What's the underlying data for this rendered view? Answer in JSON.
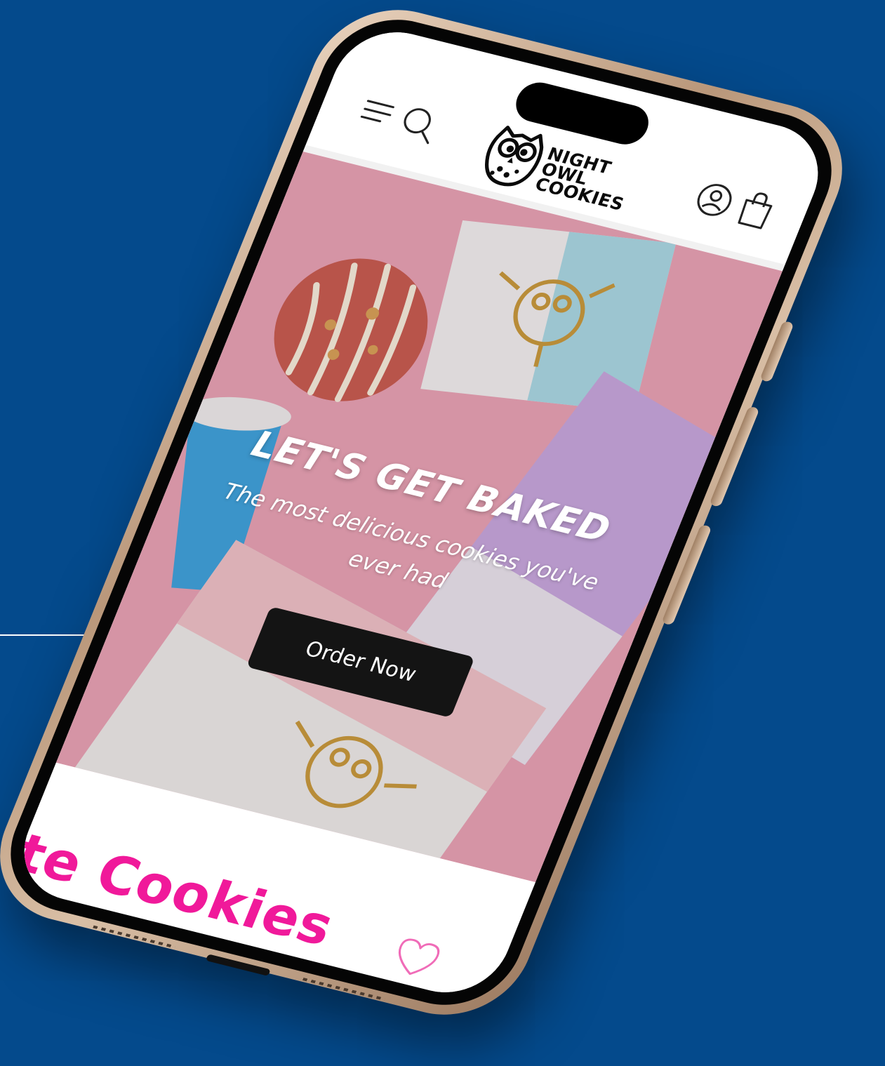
{
  "colors": {
    "background": "#044a8c",
    "accent_pink": "#f0199a",
    "button_dark": "#141414",
    "hero_pink": "#e9a3b6"
  },
  "header": {
    "logo_lines": [
      "NIGHT",
      "OWL",
      "COOKIES"
    ],
    "icons": [
      "menu-icon",
      "search-icon",
      "account-icon",
      "cart-icon"
    ]
  },
  "hero": {
    "title": "LET'S GET BAKED",
    "subtitle": "The most delicious cookies you've ever had",
    "button_label": "Order Now"
  },
  "favorites": {
    "title": "orite Cookies",
    "icon": "heart-icon"
  }
}
